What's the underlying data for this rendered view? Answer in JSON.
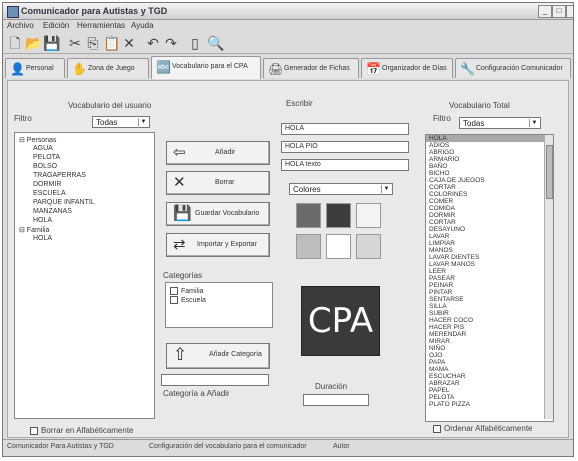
{
  "window": {
    "title": "Comunicador para Autistas y TGD",
    "controls": [
      "_",
      "□",
      "×"
    ]
  },
  "menu": [
    "Archivo",
    "Edición",
    "Herramientas",
    "Ayuda"
  ],
  "toolbar": [
    "new-icon",
    "open-icon",
    "save-icon",
    "cut-icon",
    "copy-icon",
    "paste-icon",
    "delete-icon",
    "undo-icon",
    "redo-icon",
    "print-icon",
    "preview-icon"
  ],
  "tabs": [
    {
      "label": "Personal",
      "icon": "👤"
    },
    {
      "label": "Zona de Juego",
      "icon": "✋"
    },
    {
      "label": "Vocabulario para el CPA",
      "icon": "🔤"
    },
    {
      "label": "Generador de Fichas",
      "icon": "🖨"
    },
    {
      "label": "Organizador de Días",
      "icon": "📅"
    },
    {
      "label": "Configuración Comunicador",
      "icon": "🔧"
    }
  ],
  "left_panel": {
    "title": "Vocabulario del usuario",
    "filter_label": "Filtro",
    "filter_value": "Todas",
    "tree": [
      {
        "text": "⊟ Personas",
        "indent": 0
      },
      {
        "text": "AGUA",
        "indent": 1
      },
      {
        "text": "PELOTA",
        "indent": 1
      },
      {
        "text": "BOLSO",
        "indent": 1
      },
      {
        "text": "TRAGAPERRAS",
        "indent": 1
      },
      {
        "text": "DORMIR",
        "indent": 1
      },
      {
        "text": "ESCUELA",
        "indent": 1
      },
      {
        "text": "PARQUE INFANTIL",
        "indent": 1
      },
      {
        "text": "MANZANAS",
        "indent": 1
      },
      {
        "text": "HOLA",
        "indent": 1
      },
      {
        "text": "⊟ Familia",
        "indent": 0
      },
      {
        "text": "HOLA",
        "indent": 1
      }
    ],
    "checkbox_label": "Borrar en Alfabéticamente"
  },
  "actions": {
    "add": "Añadir",
    "delete": "Borrar",
    "save": "Guardar Vocabulario",
    "import": "Importar y Exportar",
    "category_label": "Categorías",
    "categories": [
      "Familia",
      "Escuela"
    ],
    "add_category": "Añadir Categoría",
    "category_label2": "Categoría a Añadir"
  },
  "middle": {
    "word_label": "Escribir",
    "field1": "HOLA",
    "field2": "HOLA PIO",
    "field3": "HOLA texto",
    "color_label": "Colores",
    "preview_text": "CPA",
    "duration_label": "Duración",
    "swatches": [
      "#6b6b6b",
      "#3d3d3d",
      "#f4f4f4",
      "#bdbdbd",
      "#ffffff",
      "#d6d6d6"
    ]
  },
  "right_panel": {
    "title": "Vocabulario Total",
    "filter_label": "Filtro",
    "filter_value": "Todas",
    "items": [
      "HOLA",
      "ADIOS",
      "ABRIGO",
      "ARMARIO",
      "BAÑO",
      "BICHO",
      "CAJA DE JUEGOS",
      "CORTAR",
      "COLORINES",
      "COMER",
      "COMIDA",
      "DORMIR",
      "CORTAR",
      "DESAYUNO",
      "LAVAR",
      "LIMPIAR",
      "MANOS",
      "LAVAR DIENTES",
      "LAVAR MANOS",
      "LEER",
      "PASEAR",
      "PEINAR",
      "PINTAR",
      "SENTARSE",
      "SILLA",
      "SUBIR",
      "HACER COCO",
      "HACER PIS",
      "MERENDAR",
      "MIRAR",
      "NIÑO",
      "OJO",
      "PAPA",
      "MAMA",
      "ESCUCHAR",
      "ABRAZAR",
      "PAPEL",
      "PELOTA",
      "PLATO PIZZA"
    ],
    "checkbox_label": "Ordenar Alfabéticamente"
  },
  "status": [
    "Comunicador Para Autistas y TGD",
    "Configuración del vocabulario para el comunicador",
    "Autor"
  ]
}
